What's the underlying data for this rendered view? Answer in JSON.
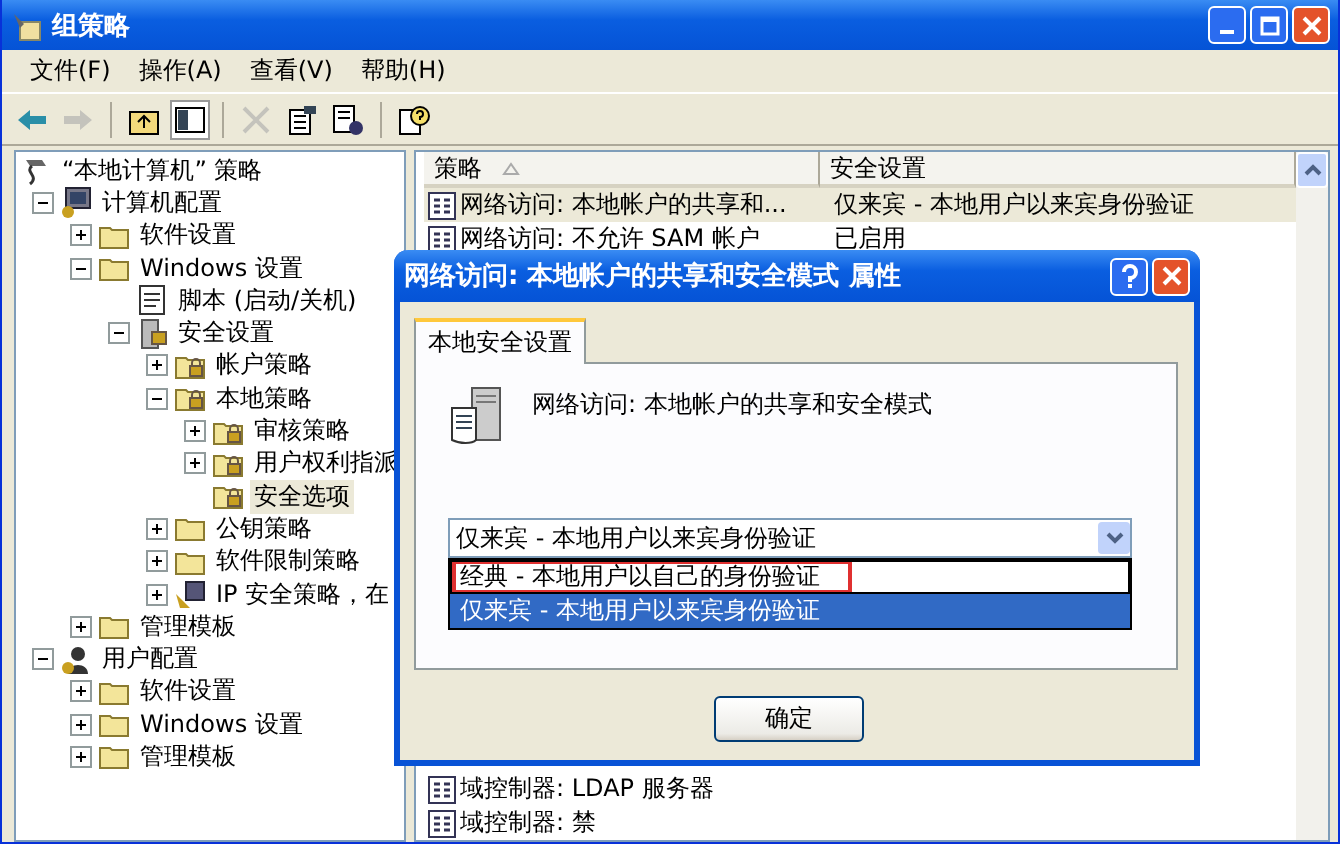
{
  "window": {
    "title": "组策略"
  },
  "menu": [
    "文件(F)",
    "操作(A)",
    "查看(V)",
    "帮助(H)"
  ],
  "toolbar": [
    {
      "kind": "back",
      "disabled": false
    },
    {
      "kind": "forward",
      "disabled": true
    },
    {
      "kind": "sep"
    },
    {
      "kind": "up",
      "disabled": false
    },
    {
      "kind": "tree",
      "disabled": false
    },
    {
      "kind": "sep"
    },
    {
      "kind": "delete",
      "disabled": true
    },
    {
      "kind": "properties",
      "disabled": false
    },
    {
      "kind": "export",
      "disabled": false
    },
    {
      "kind": "sep"
    },
    {
      "kind": "help",
      "disabled": false
    }
  ],
  "tree": [
    {
      "label": "“本地计算机” 策略",
      "kind": "policy",
      "selected": false,
      "children": [
        {
          "label": "计算机配置",
          "kind": "computer",
          "expanded": true,
          "selected": false,
          "children": [
            {
              "label": "软件设置",
              "kind": "folder",
              "expanded": false,
              "selected": false
            },
            {
              "label": "Windows 设置",
              "kind": "folder",
              "expanded": true,
              "selected": false,
              "children": [
                {
                  "label": "脚本 (启动/关机)",
                  "kind": "script",
                  "selected": false
                },
                {
                  "label": "安全设置",
                  "kind": "secure",
                  "expanded": true,
                  "selected": false,
                  "children": [
                    {
                      "label": "帐户策略",
                      "kind": "lockfolder",
                      "expanded": false,
                      "selected": false
                    },
                    {
                      "label": "本地策略",
                      "kind": "lockfolder",
                      "expanded": true,
                      "selected": false,
                      "children": [
                        {
                          "label": "审核策略",
                          "kind": "lockfolder",
                          "expanded": false,
                          "selected": false
                        },
                        {
                          "label": "用户权利指派",
                          "kind": "lockfolder",
                          "expanded": false,
                          "selected": false
                        },
                        {
                          "label": "安全选项",
                          "kind": "lockfolder",
                          "selected": true
                        }
                      ]
                    },
                    {
                      "label": "公钥策略",
                      "kind": "folder",
                      "expanded": false,
                      "selected": false
                    },
                    {
                      "label": "软件限制策略",
                      "kind": "folder",
                      "expanded": false,
                      "selected": false
                    },
                    {
                      "label": "IP 安全策略，在",
                      "kind": "ip",
                      "expanded": false,
                      "selected": false
                    }
                  ]
                }
              ]
            },
            {
              "label": "管理模板",
              "kind": "folder",
              "expanded": false,
              "selected": false
            }
          ]
        },
        {
          "label": "用户配置",
          "kind": "user",
          "expanded": true,
          "selected": false,
          "children": [
            {
              "label": "软件设置",
              "kind": "folder",
              "expanded": false,
              "selected": false
            },
            {
              "label": "Windows 设置",
              "kind": "folder",
              "expanded": false,
              "selected": false
            },
            {
              "label": "管理模板",
              "kind": "folder",
              "expanded": false,
              "selected": false
            }
          ]
        }
      ]
    }
  ],
  "list": {
    "columns": [
      "策略",
      "安全设置"
    ],
    "rows_top": [
      {
        "policy": "网络访问: 本地帐户的共享和...",
        "setting": "仅来宾 - 本地用户以来宾身份验证",
        "selected": true
      },
      {
        "policy": "网络访问: 不允许 SAM 帐户",
        "setting": "已启用",
        "selected": false
      }
    ],
    "rows_bottom": [
      {
        "policy": "域控制器: LDAP 服务器",
        "selected": false
      },
      {
        "policy": "域控制器: 禁",
        "selected": false
      }
    ]
  },
  "dialog": {
    "title": "网络访问: 本地帐户的共享和安全模式 属性",
    "tabs": [
      {
        "label": "本地安全设置",
        "selected": true
      }
    ],
    "description": "网络访问: 本地帐户的共享和安全模式",
    "combo": {
      "value": "仅来宾 - 本地用户以来宾身份验证",
      "options": [
        {
          "label": "经典 - 本地用户以自己的身份验证",
          "selected": false,
          "highlighted": true
        },
        {
          "label": "仅来宾 - 本地用户以来宾身份验证",
          "selected": true,
          "highlighted": false
        }
      ]
    },
    "buttons": [
      "确定"
    ]
  }
}
